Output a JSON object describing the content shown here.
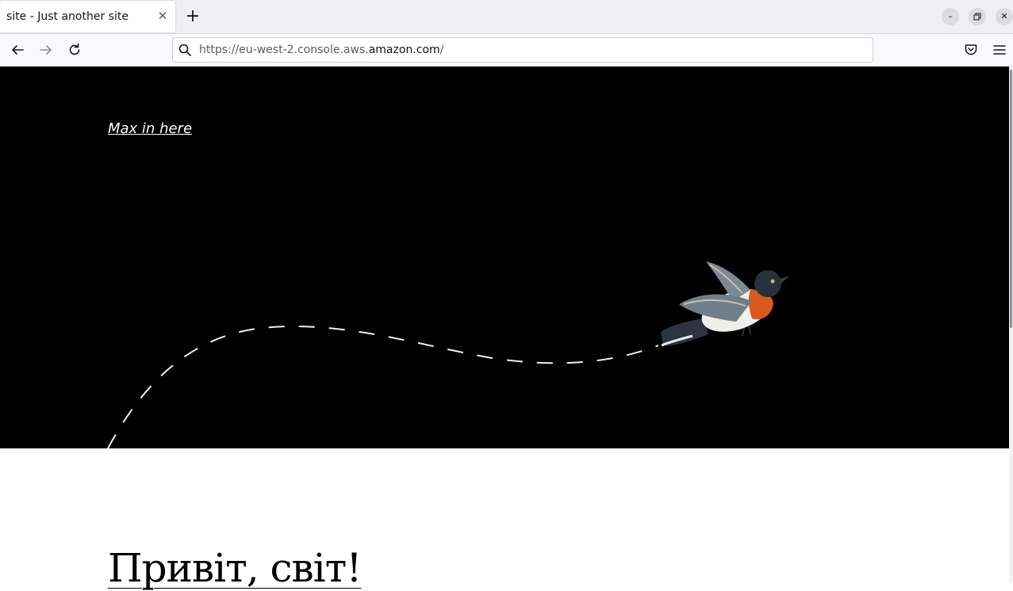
{
  "browser": {
    "tab": {
      "title": "site - Just another site"
    },
    "url": {
      "prefix": "https://eu-west-2.console.aws.",
      "domain": "amazon.com",
      "suffix": "/"
    },
    "icons": {
      "close_tab": "close-icon",
      "new_tab": "plus-icon",
      "back": "back-arrow-icon",
      "forward": "forward-arrow-icon",
      "reload": "reload-icon",
      "search": "search-icon",
      "pocket": "pocket-icon",
      "menu": "hamburger-menu-icon",
      "minimize": "minimize-icon",
      "restore": "restore-icon",
      "close_window": "close-icon"
    }
  },
  "page": {
    "site_title": "Max in here",
    "post_title": "Привіт, світ!",
    "hero_background": "#000000",
    "bird_image": "bird-illustration"
  }
}
